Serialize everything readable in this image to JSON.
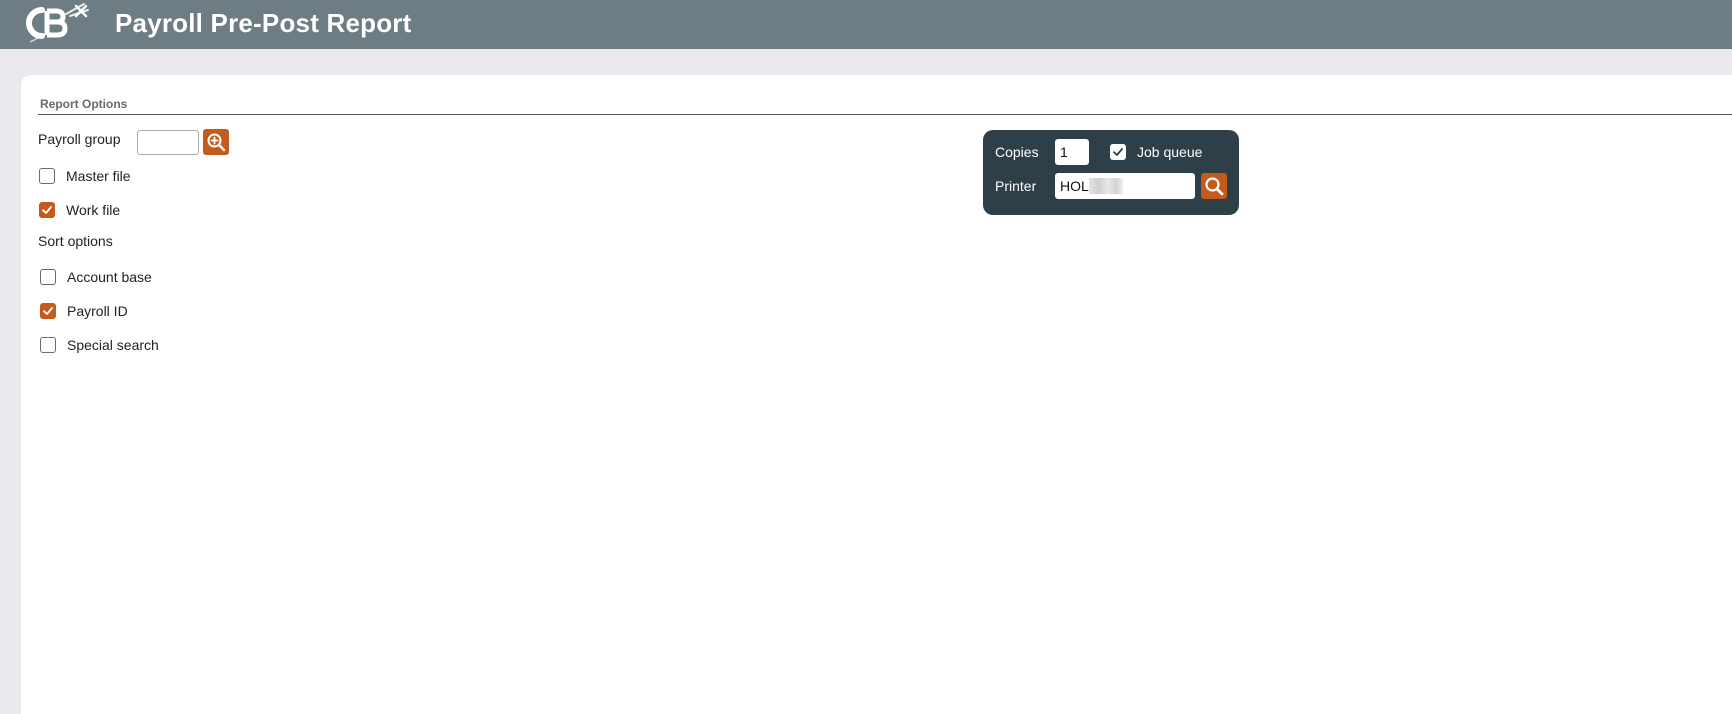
{
  "header": {
    "app_title": "Payroll Pre-Post Report",
    "logo_icon": "cb-logo-icon"
  },
  "report_options": {
    "legend": "Report Options",
    "payroll_group": {
      "label": "Payroll group",
      "value": "",
      "lookup_icon": "zoom-in-icon"
    },
    "file_options": [
      {
        "label": "Master file",
        "checked": false
      },
      {
        "label": "Work file",
        "checked": true
      }
    ],
    "sort_heading": "Sort options",
    "sort_options": [
      {
        "label": "Account base",
        "checked": false
      },
      {
        "label": "Payroll ID",
        "checked": true
      },
      {
        "label": "Special search",
        "checked": false
      }
    ]
  },
  "print_settings": {
    "copies_label": "Copies",
    "copies_value": "1",
    "job_queue_label": "Job queue",
    "job_queue_checked": true,
    "printer_label": "Printer",
    "printer_value": "HOL",
    "printer_search_icon": "search-icon"
  },
  "colors": {
    "header_bg": "#6d7d83",
    "accent": "#c45a1c",
    "print_box_bg": "#2f3f48",
    "page_bg": "#e9e9ee"
  }
}
